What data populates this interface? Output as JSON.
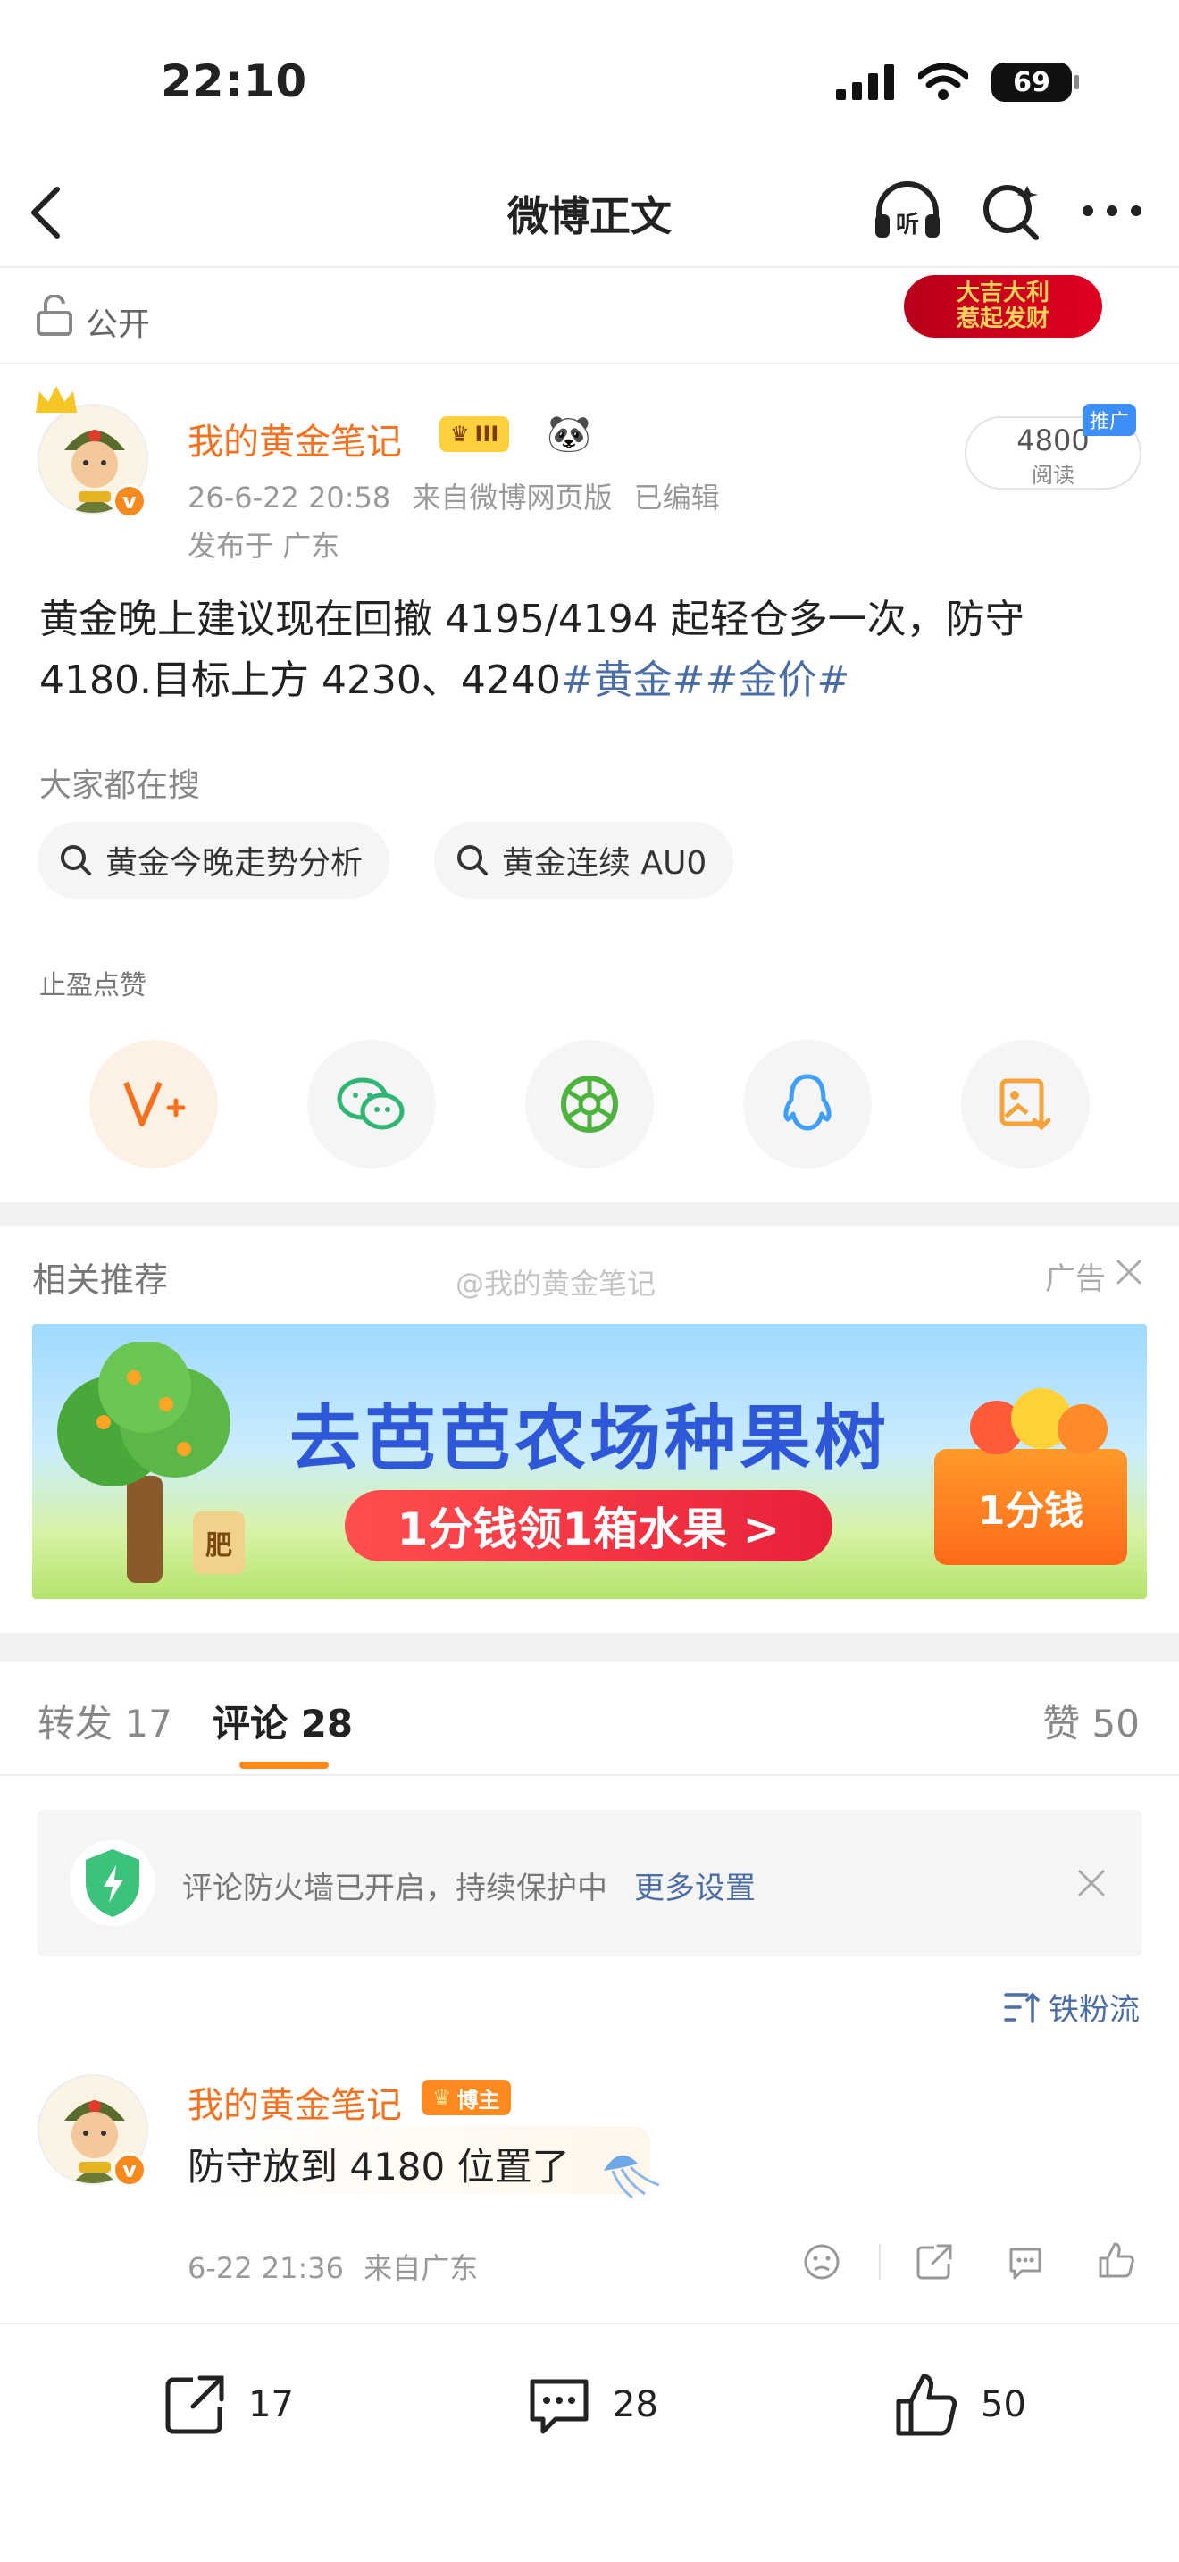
{
  "status_bar": {
    "time": "22:10",
    "battery": "69"
  },
  "nav": {
    "title": "微博正文"
  },
  "visibility": {
    "label": "公开"
  },
  "ad_badge": {
    "line1": "大吉大利",
    "line2": "惹起发财"
  },
  "post": {
    "username": "我的黄金笔记",
    "level": "III",
    "timestamp": "26-6-22 20:58",
    "source": "来自微博网页版",
    "edited": "已编辑",
    "location": "发布于 广东",
    "read_count": "4800",
    "read_label": "阅读",
    "promo_tag": "推广",
    "text": "黄金晚上建议现在回撤 4195/4194 起轻仓多一次，防守 4180.目标上方 4230、4240",
    "hashtag1": "#黄金#",
    "hashtag2": "#金价#"
  },
  "hot_search": {
    "label": "大家都在搜",
    "items": [
      "黄金今晚走势分析",
      "黄金连续 AU0"
    ]
  },
  "like_tip": "止盈点赞",
  "related": {
    "title": "相关推荐",
    "watermark": "@我的黄金笔记",
    "ad_label": "广告",
    "banner_title": "去芭芭农场种果树",
    "banner_button": "1分钱领1箱水果 >",
    "banner_box": "1分钱",
    "banner_pot": "肥"
  },
  "tabs": {
    "repost": "转发 17",
    "comments": "评论 28",
    "likes": "赞 50"
  },
  "firewall": {
    "text": "评论防火墙已开启，持续保护中",
    "link": "更多设置"
  },
  "sort_label": "铁粉流",
  "comment": {
    "username": "我的黄金笔记",
    "badge": "博主",
    "text": "防守放到 4180 位置了",
    "time": "6-22 21:36",
    "location": "来自广东"
  },
  "bottom_bar": {
    "repost_count": "17",
    "comment_count": "28",
    "like_count": "50"
  },
  "colors": {
    "accent_orange": "#f5711f",
    "link_blue": "#4b6da5",
    "tab_indicator": "#ff8a1f"
  }
}
